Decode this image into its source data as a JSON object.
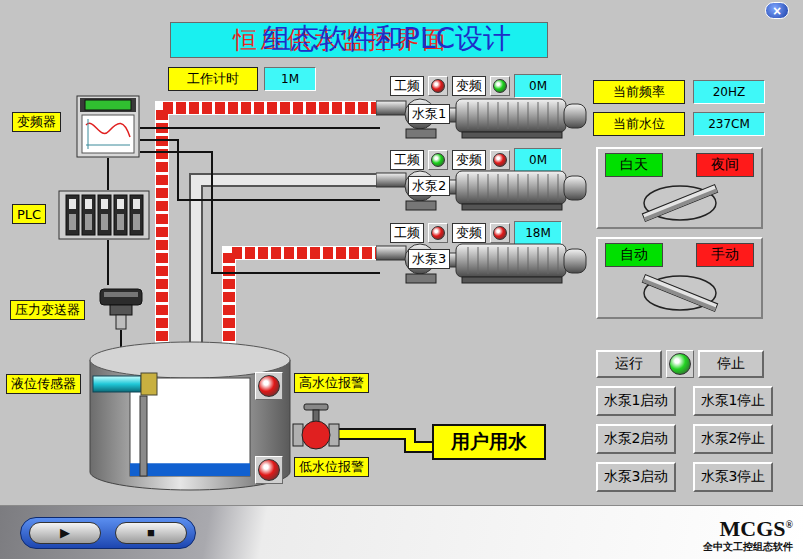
{
  "window": {
    "close": "×"
  },
  "title": {
    "main": "恒压供水监控界面",
    "sub": "组态软件和PLC设计"
  },
  "timer": {
    "label": "工作计时",
    "value": "1M"
  },
  "devices": {
    "inverter": "变频器",
    "plc": "PLC",
    "pressure": "压力变送器",
    "level_sensor": "液位传感器"
  },
  "pumps": [
    {
      "name": "水泵1",
      "power_freq": {
        "label": "工频",
        "on": false
      },
      "variable_freq": {
        "label": "变频",
        "on": true
      },
      "value": "0M",
      "flowing": true
    },
    {
      "name": "水泵2",
      "power_freq": {
        "label": "工频",
        "on": true
      },
      "variable_freq": {
        "label": "变频",
        "on": false
      },
      "value": "0M",
      "flowing": false
    },
    {
      "name": "水泵3",
      "power_freq": {
        "label": "工频",
        "on": false
      },
      "variable_freq": {
        "label": "变频",
        "on": false
      },
      "value": "18M",
      "flowing": true
    }
  ],
  "tank": {
    "level": 0.13,
    "alarms": [
      {
        "label": "高水位报警",
        "on": true
      },
      {
        "label": "低水位报警",
        "on": true
      }
    ]
  },
  "outlet": {
    "label": "用户用水"
  },
  "readings": [
    {
      "label": "当前频率",
      "value": "20HZ"
    },
    {
      "label": "当前水位",
      "value": "237CM"
    }
  ],
  "switches": [
    {
      "options": [
        {
          "label": "白天",
          "color": "#00e000",
          "selected": false
        },
        {
          "label": "夜间",
          "color": "#ff1a1a",
          "selected": true
        }
      ]
    },
    {
      "options": [
        {
          "label": "自动",
          "color": "#00e000",
          "selected": true
        },
        {
          "label": "手动",
          "color": "#ff1a1a",
          "selected": false
        }
      ]
    }
  ],
  "run": {
    "start": "运行",
    "stop": "停止",
    "running": true
  },
  "pump_controls": [
    {
      "start": "水泵1启动",
      "stop": "水泵1停止"
    },
    {
      "start": "水泵2启动",
      "stop": "水泵2停止"
    },
    {
      "start": "水泵3启动",
      "stop": "水泵3停止"
    }
  ],
  "player": {
    "play": "▶",
    "stop": "■"
  },
  "logo": {
    "brand": "MCGS",
    "mark": "®",
    "tagline": "全中文工控组态软件"
  }
}
